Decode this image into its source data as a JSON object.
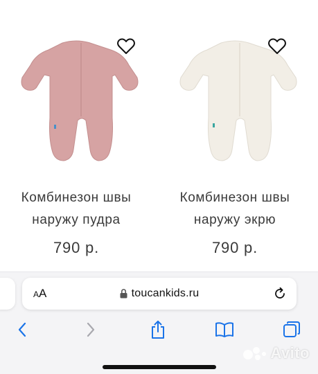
{
  "products": [
    {
      "title_line1": "Комбинезон швы",
      "title_line2": "наружу пудра",
      "price": "790 р.",
      "color": "#d4a1a1"
    },
    {
      "title_line1": "Комбинезон швы",
      "title_line2": "наружу экрю",
      "price": "790 р.",
      "color": "#f1ede5"
    }
  ],
  "browser": {
    "text_size_big": "A",
    "text_size_small": "A",
    "url": "toucankids.ru"
  },
  "watermark": "Avito"
}
